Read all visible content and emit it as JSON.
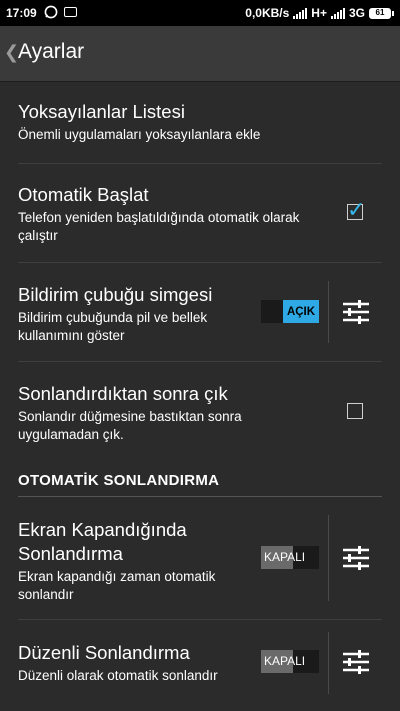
{
  "status_bar": {
    "time": "17:09",
    "right_text": "0,0KB/s",
    "network_type_1": "H+",
    "network_type_2": "3G",
    "battery": "61"
  },
  "header": {
    "back_icon": "chevron-left-icon",
    "title": "Ayarlar"
  },
  "settings": [
    {
      "title": "Yoksayılanlar Listesi",
      "subtitle": "Önemli uygulamaları yoksayılanlara ekle"
    },
    {
      "title": "Otomatik Başlat",
      "subtitle_line1": "Telefon yeniden başlatıldığında otomatik olarak",
      "subtitle_line2": "çalıştır",
      "checked": true
    },
    {
      "title": "Bildirim çubuğu simgesi",
      "subtitle_line1": "Bildirim çubuğunda pil ve bellek",
      "subtitle_line2": "kullanımını göster",
      "toggle": "AÇIK"
    },
    {
      "title": "Sonlandırdıktan sonra çık",
      "subtitle_line1": "Sonlandır düğmesine bastıktan sonra",
      "subtitle_line2": "uygulamadan çık.",
      "checked": false
    }
  ],
  "section_header": "OTOMATİK SONLANDIRMA",
  "auto_kill": [
    {
      "title_line1": "Ekran Kapandığında",
      "title_line2": "Sonlandırma",
      "subtitle_line1": "Ekran kapandığı zaman otomatik",
      "subtitle_line2": "sonlandır",
      "toggle": "KAPALI"
    },
    {
      "title": "Düzenli Sonlandırma",
      "subtitle": "Düzenli olarak otomatik sonlandır",
      "toggle": "KAPALI"
    }
  ],
  "colors": {
    "accent": "#2fa9e5",
    "background": "#2b2b2b",
    "titlebar": "#3a3a3a"
  }
}
